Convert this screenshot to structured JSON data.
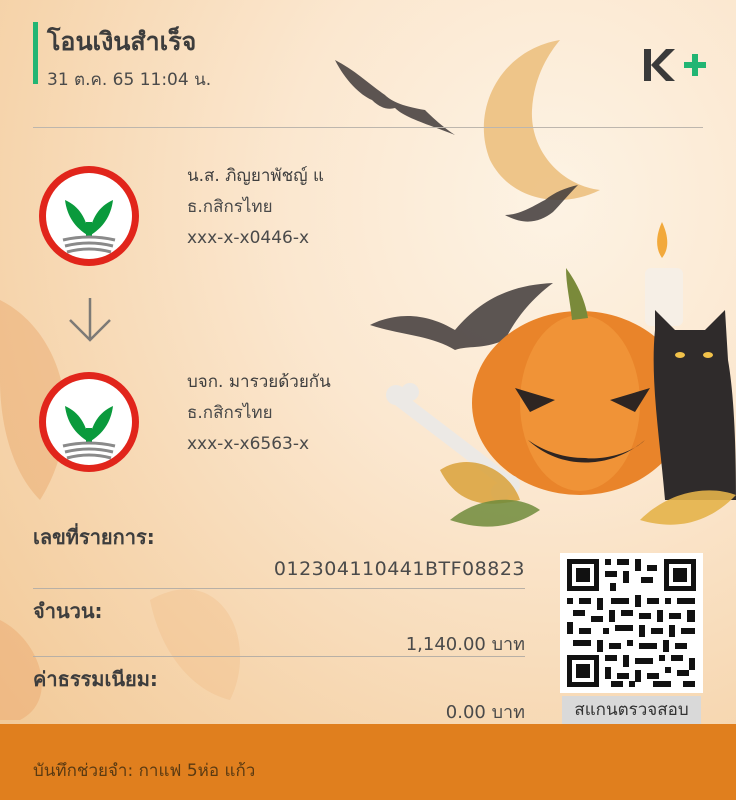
{
  "header": {
    "title": "โอนเงินสำเร็จ",
    "datetime": "31 ต.ค. 65  11:04 น."
  },
  "brand": {
    "logo_text": "K+",
    "accent_color": "#22b573",
    "brand_dark": "#3a3a3a"
  },
  "sender": {
    "name": "น.ส. ภิญยาพัชญ์ แ",
    "bank": "ธ.กสิกรไทย",
    "account": "xxx-x-x0446-x",
    "logo": "kasikorn-bank-logo"
  },
  "receiver": {
    "name": "บจก. มารวยด้วยกัน",
    "bank": "ธ.กสิกรไทย",
    "account": "xxx-x-x6563-x",
    "logo": "kasikorn-bank-logo"
  },
  "details": {
    "ref_label": "เลขที่รายการ:",
    "ref_value": "012304110441BTF08823",
    "amount_label": "จำนวน:",
    "amount_value": "1,140.00 บาท",
    "fee_label": "ค่าธรรมเนียม:",
    "fee_value": "0.00 บาท"
  },
  "qr": {
    "caption": "สแกนตรวจสอบ"
  },
  "footer": {
    "memo_label": "บันทึกช่วยจำ:",
    "memo_value": "กาแฟ 5ห่อ แก้ว",
    "color": "#e07f1e"
  }
}
